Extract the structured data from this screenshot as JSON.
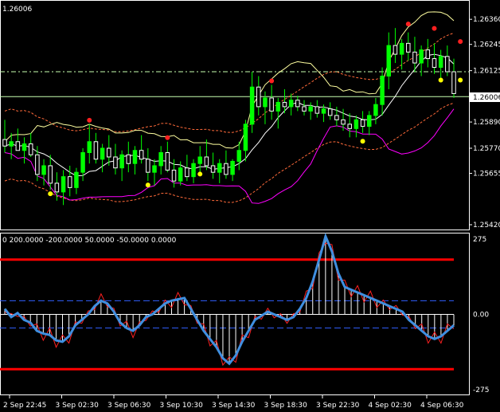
{
  "colors": {
    "background": "#000000",
    "frame": "#ffffff",
    "bull_candle": "#00ff00",
    "bear_candle": "#ffffff",
    "ma_fast": "#ffffff",
    "bollinger": "#ffffa0",
    "envelope": "#ff6a3a",
    "lower_trend": "#ff00ff",
    "level_line": "#c8ffb0",
    "cci_main": "#3f8fe0",
    "cci_signal": "#ff2020",
    "cci_threshold": "#ff0000",
    "cci_dash": "#3060ff",
    "fractal_up": "#ff2020",
    "fractal_down": "#ffff00"
  },
  "main_panel": {
    "symbol_price": "1.26006",
    "price_axis": [
      "1.26360",
      "1.26245",
      "1.26125",
      "1.26006",
      "1.25890",
      "1.25770",
      "1.25655",
      "1.25420"
    ],
    "current_price_badge": "1.26006"
  },
  "sub_panel": {
    "indicator_header": "0 200.0000 -200.0000 50.0000 -50.0000 0.0000",
    "axis": [
      "275",
      "0.00",
      "-275"
    ]
  },
  "time_axis": [
    "2 Sep 22:45",
    "3 Sep 02:30",
    "3 Sep 06:30",
    "3 Sep 10:30",
    "3 Sep 14:30",
    "3 Sep 18:30",
    "3 Sep 22:30",
    "4 Sep 02:30",
    "4 Sep 06:30"
  ],
  "chart_data": [
    {
      "type": "candlestick",
      "title": "",
      "ylim": [
        1.2542,
        1.2643
      ],
      "note_levels": [
        1.2612,
        1.26006
      ],
      "candles": [
        {
          "o": 1.2581,
          "h": 1.259,
          "l": 1.2575,
          "c": 1.2578
        },
        {
          "o": 1.2578,
          "h": 1.2584,
          "l": 1.2572,
          "c": 1.258
        },
        {
          "o": 1.258,
          "h": 1.2586,
          "l": 1.2576,
          "c": 1.2576
        },
        {
          "o": 1.2576,
          "h": 1.2582,
          "l": 1.257,
          "c": 1.2579
        },
        {
          "o": 1.2579,
          "h": 1.2584,
          "l": 1.2573,
          "c": 1.2574
        },
        {
          "o": 1.2574,
          "h": 1.2578,
          "l": 1.2562,
          "c": 1.2565
        },
        {
          "o": 1.2565,
          "h": 1.2572,
          "l": 1.256,
          "c": 1.2569
        },
        {
          "o": 1.2569,
          "h": 1.2574,
          "l": 1.2558,
          "c": 1.2561
        },
        {
          "o": 1.2561,
          "h": 1.2566,
          "l": 1.2553,
          "c": 1.2557
        },
        {
          "o": 1.2557,
          "h": 1.2567,
          "l": 1.2551,
          "c": 1.2564
        },
        {
          "o": 1.2564,
          "h": 1.2569,
          "l": 1.2555,
          "c": 1.2559
        },
        {
          "o": 1.2559,
          "h": 1.2568,
          "l": 1.2556,
          "c": 1.2566
        },
        {
          "o": 1.2566,
          "h": 1.2577,
          "l": 1.2562,
          "c": 1.2575
        },
        {
          "o": 1.2575,
          "h": 1.2588,
          "l": 1.257,
          "c": 1.258
        },
        {
          "o": 1.258,
          "h": 1.2584,
          "l": 1.257,
          "c": 1.2572
        },
        {
          "o": 1.2572,
          "h": 1.2579,
          "l": 1.2566,
          "c": 1.2577
        },
        {
          "o": 1.2577,
          "h": 1.2583,
          "l": 1.2569,
          "c": 1.2573
        },
        {
          "o": 1.2573,
          "h": 1.2579,
          "l": 1.2565,
          "c": 1.2568
        },
        {
          "o": 1.2568,
          "h": 1.2576,
          "l": 1.2562,
          "c": 1.2574
        },
        {
          "o": 1.2574,
          "h": 1.258,
          "l": 1.2566,
          "c": 1.257
        },
        {
          "o": 1.257,
          "h": 1.2578,
          "l": 1.2565,
          "c": 1.2576
        },
        {
          "o": 1.2576,
          "h": 1.2583,
          "l": 1.257,
          "c": 1.2572
        },
        {
          "o": 1.2572,
          "h": 1.2577,
          "l": 1.2562,
          "c": 1.2566
        },
        {
          "o": 1.2566,
          "h": 1.2572,
          "l": 1.256,
          "c": 1.2569
        },
        {
          "o": 1.2569,
          "h": 1.2578,
          "l": 1.2565,
          "c": 1.2575
        },
        {
          "o": 1.2575,
          "h": 1.258,
          "l": 1.2566,
          "c": 1.2567
        },
        {
          "o": 1.2567,
          "h": 1.2572,
          "l": 1.2559,
          "c": 1.2562
        },
        {
          "o": 1.2562,
          "h": 1.2571,
          "l": 1.256,
          "c": 1.2568
        },
        {
          "o": 1.2568,
          "h": 1.2574,
          "l": 1.2562,
          "c": 1.2564
        },
        {
          "o": 1.2564,
          "h": 1.2572,
          "l": 1.2561,
          "c": 1.257
        },
        {
          "o": 1.257,
          "h": 1.2578,
          "l": 1.2566,
          "c": 1.2573
        },
        {
          "o": 1.2573,
          "h": 1.2581,
          "l": 1.2567,
          "c": 1.2569
        },
        {
          "o": 1.2569,
          "h": 1.2575,
          "l": 1.2563,
          "c": 1.2566
        },
        {
          "o": 1.2566,
          "h": 1.2572,
          "l": 1.2561,
          "c": 1.257
        },
        {
          "o": 1.257,
          "h": 1.2576,
          "l": 1.2563,
          "c": 1.2565
        },
        {
          "o": 1.2565,
          "h": 1.2572,
          "l": 1.2562,
          "c": 1.2571
        },
        {
          "o": 1.2571,
          "h": 1.258,
          "l": 1.2567,
          "c": 1.2576
        },
        {
          "o": 1.2576,
          "h": 1.259,
          "l": 1.2571,
          "c": 1.2588
        },
        {
          "o": 1.2588,
          "h": 1.2612,
          "l": 1.2584,
          "c": 1.2605
        },
        {
          "o": 1.2605,
          "h": 1.261,
          "l": 1.2592,
          "c": 1.2596
        },
        {
          "o": 1.2596,
          "h": 1.2603,
          "l": 1.2588,
          "c": 1.26
        },
        {
          "o": 1.26,
          "h": 1.2606,
          "l": 1.259,
          "c": 1.2594
        },
        {
          "o": 1.2594,
          "h": 1.26,
          "l": 1.2586,
          "c": 1.2598
        },
        {
          "o": 1.2598,
          "h": 1.2604,
          "l": 1.2593,
          "c": 1.2596
        },
        {
          "o": 1.2596,
          "h": 1.2602,
          "l": 1.2592,
          "c": 1.2599
        },
        {
          "o": 1.2599,
          "h": 1.2601,
          "l": 1.2594,
          "c": 1.2596
        },
        {
          "o": 1.2596,
          "h": 1.2599,
          "l": 1.2592,
          "c": 1.2594
        },
        {
          "o": 1.2594,
          "h": 1.2598,
          "l": 1.259,
          "c": 1.2596
        },
        {
          "o": 1.2596,
          "h": 1.2599,
          "l": 1.2591,
          "c": 1.2593
        },
        {
          "o": 1.2593,
          "h": 1.2597,
          "l": 1.2589,
          "c": 1.2595
        },
        {
          "o": 1.2595,
          "h": 1.2598,
          "l": 1.259,
          "c": 1.2592
        },
        {
          "o": 1.2592,
          "h": 1.2596,
          "l": 1.2587,
          "c": 1.259
        },
        {
          "o": 1.259,
          "h": 1.2595,
          "l": 1.2585,
          "c": 1.2588
        },
        {
          "o": 1.2588,
          "h": 1.2593,
          "l": 1.2582,
          "c": 1.2586
        },
        {
          "o": 1.2586,
          "h": 1.2592,
          "l": 1.2582,
          "c": 1.259
        },
        {
          "o": 1.259,
          "h": 1.2594,
          "l": 1.2584,
          "c": 1.2587
        },
        {
          "o": 1.2587,
          "h": 1.2594,
          "l": 1.2583,
          "c": 1.2592
        },
        {
          "o": 1.2592,
          "h": 1.26,
          "l": 1.2588,
          "c": 1.2597
        },
        {
          "o": 1.2597,
          "h": 1.2614,
          "l": 1.2592,
          "c": 1.261
        },
        {
          "o": 1.261,
          "h": 1.263,
          "l": 1.2604,
          "c": 1.2624
        },
        {
          "o": 1.2624,
          "h": 1.2632,
          "l": 1.2616,
          "c": 1.262
        },
        {
          "o": 1.262,
          "h": 1.2627,
          "l": 1.2613,
          "c": 1.2625
        },
        {
          "o": 1.2625,
          "h": 1.263,
          "l": 1.2617,
          "c": 1.2621
        },
        {
          "o": 1.2621,
          "h": 1.2628,
          "l": 1.2612,
          "c": 1.2616
        },
        {
          "o": 1.2616,
          "h": 1.2624,
          "l": 1.261,
          "c": 1.2622
        },
        {
          "o": 1.2622,
          "h": 1.2627,
          "l": 1.2614,
          "c": 1.2618
        },
        {
          "o": 1.2618,
          "h": 1.2625,
          "l": 1.2611,
          "c": 1.2614
        },
        {
          "o": 1.2614,
          "h": 1.2622,
          "l": 1.2608,
          "c": 1.2619
        },
        {
          "o": 1.2619,
          "h": 1.2624,
          "l": 1.261,
          "c": 1.2612
        },
        {
          "o": 1.2612,
          "h": 1.2618,
          "l": 1.26,
          "c": 1.2602
        }
      ],
      "fractals_up": [
        {
          "i": 13,
          "v": 1.2588
        },
        {
          "i": 25,
          "v": 1.258
        },
        {
          "i": 41,
          "v": 1.2606
        },
        {
          "i": 62,
          "v": 1.2632
        },
        {
          "i": 66,
          "v": 1.263
        },
        {
          "i": 70,
          "v": 1.2624
        }
      ],
      "fractals_down": [
        {
          "i": 7,
          "v": 1.2558
        },
        {
          "i": 22,
          "v": 1.2562
        },
        {
          "i": 30,
          "v": 1.2567
        },
        {
          "i": 55,
          "v": 1.2582
        },
        {
          "i": 67,
          "v": 1.261
        },
        {
          "i": 70,
          "v": 1.261
        }
      ]
    },
    {
      "type": "line",
      "title": "",
      "ylim": [
        -275,
        275
      ],
      "thresholds": [
        200,
        -200
      ],
      "dashed_levels": [
        50,
        -50
      ],
      "series": [
        {
          "values": [
            20,
            -10,
            5,
            -20,
            -30,
            -60,
            -70,
            -75,
            -95,
            -100,
            -80,
            -40,
            -20,
            0,
            30,
            50,
            40,
            10,
            -30,
            -50,
            -60,
            -40,
            -10,
            0,
            20,
            40,
            50,
            55,
            60,
            20,
            -20,
            -60,
            -90,
            -120,
            -160,
            -180,
            -150,
            -100,
            -60,
            -20,
            -5,
            10,
            0,
            -10,
            -20,
            -10,
            20,
            60,
            120,
            200,
            285,
            230,
            150,
            100,
            90,
            80,
            70,
            60,
            50,
            40,
            30,
            20,
            10,
            -20,
            -40,
            -60,
            -80,
            -90,
            -80,
            -60,
            -40
          ]
        }
      ]
    }
  ]
}
